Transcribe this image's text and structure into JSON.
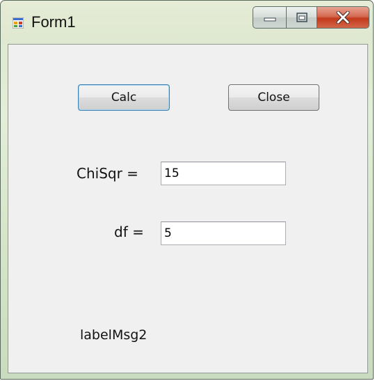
{
  "window": {
    "title": "Form1",
    "icon": "form-app-icon",
    "caption_buttons": [
      "minimize-icon",
      "maximize-icon",
      "close-icon"
    ]
  },
  "buttons": {
    "calc_label": "Calc",
    "close_label": "Close"
  },
  "fields": {
    "chisqr_label": "ChiSqr =",
    "chisqr_value": "15",
    "df_label": "df =",
    "df_value": "5"
  },
  "message": {
    "text": "labelMsg2"
  },
  "colors": {
    "client_bg": "#f0f0f0",
    "close_button_red": "#c2391c",
    "focus_border": "#3c7fb1"
  }
}
